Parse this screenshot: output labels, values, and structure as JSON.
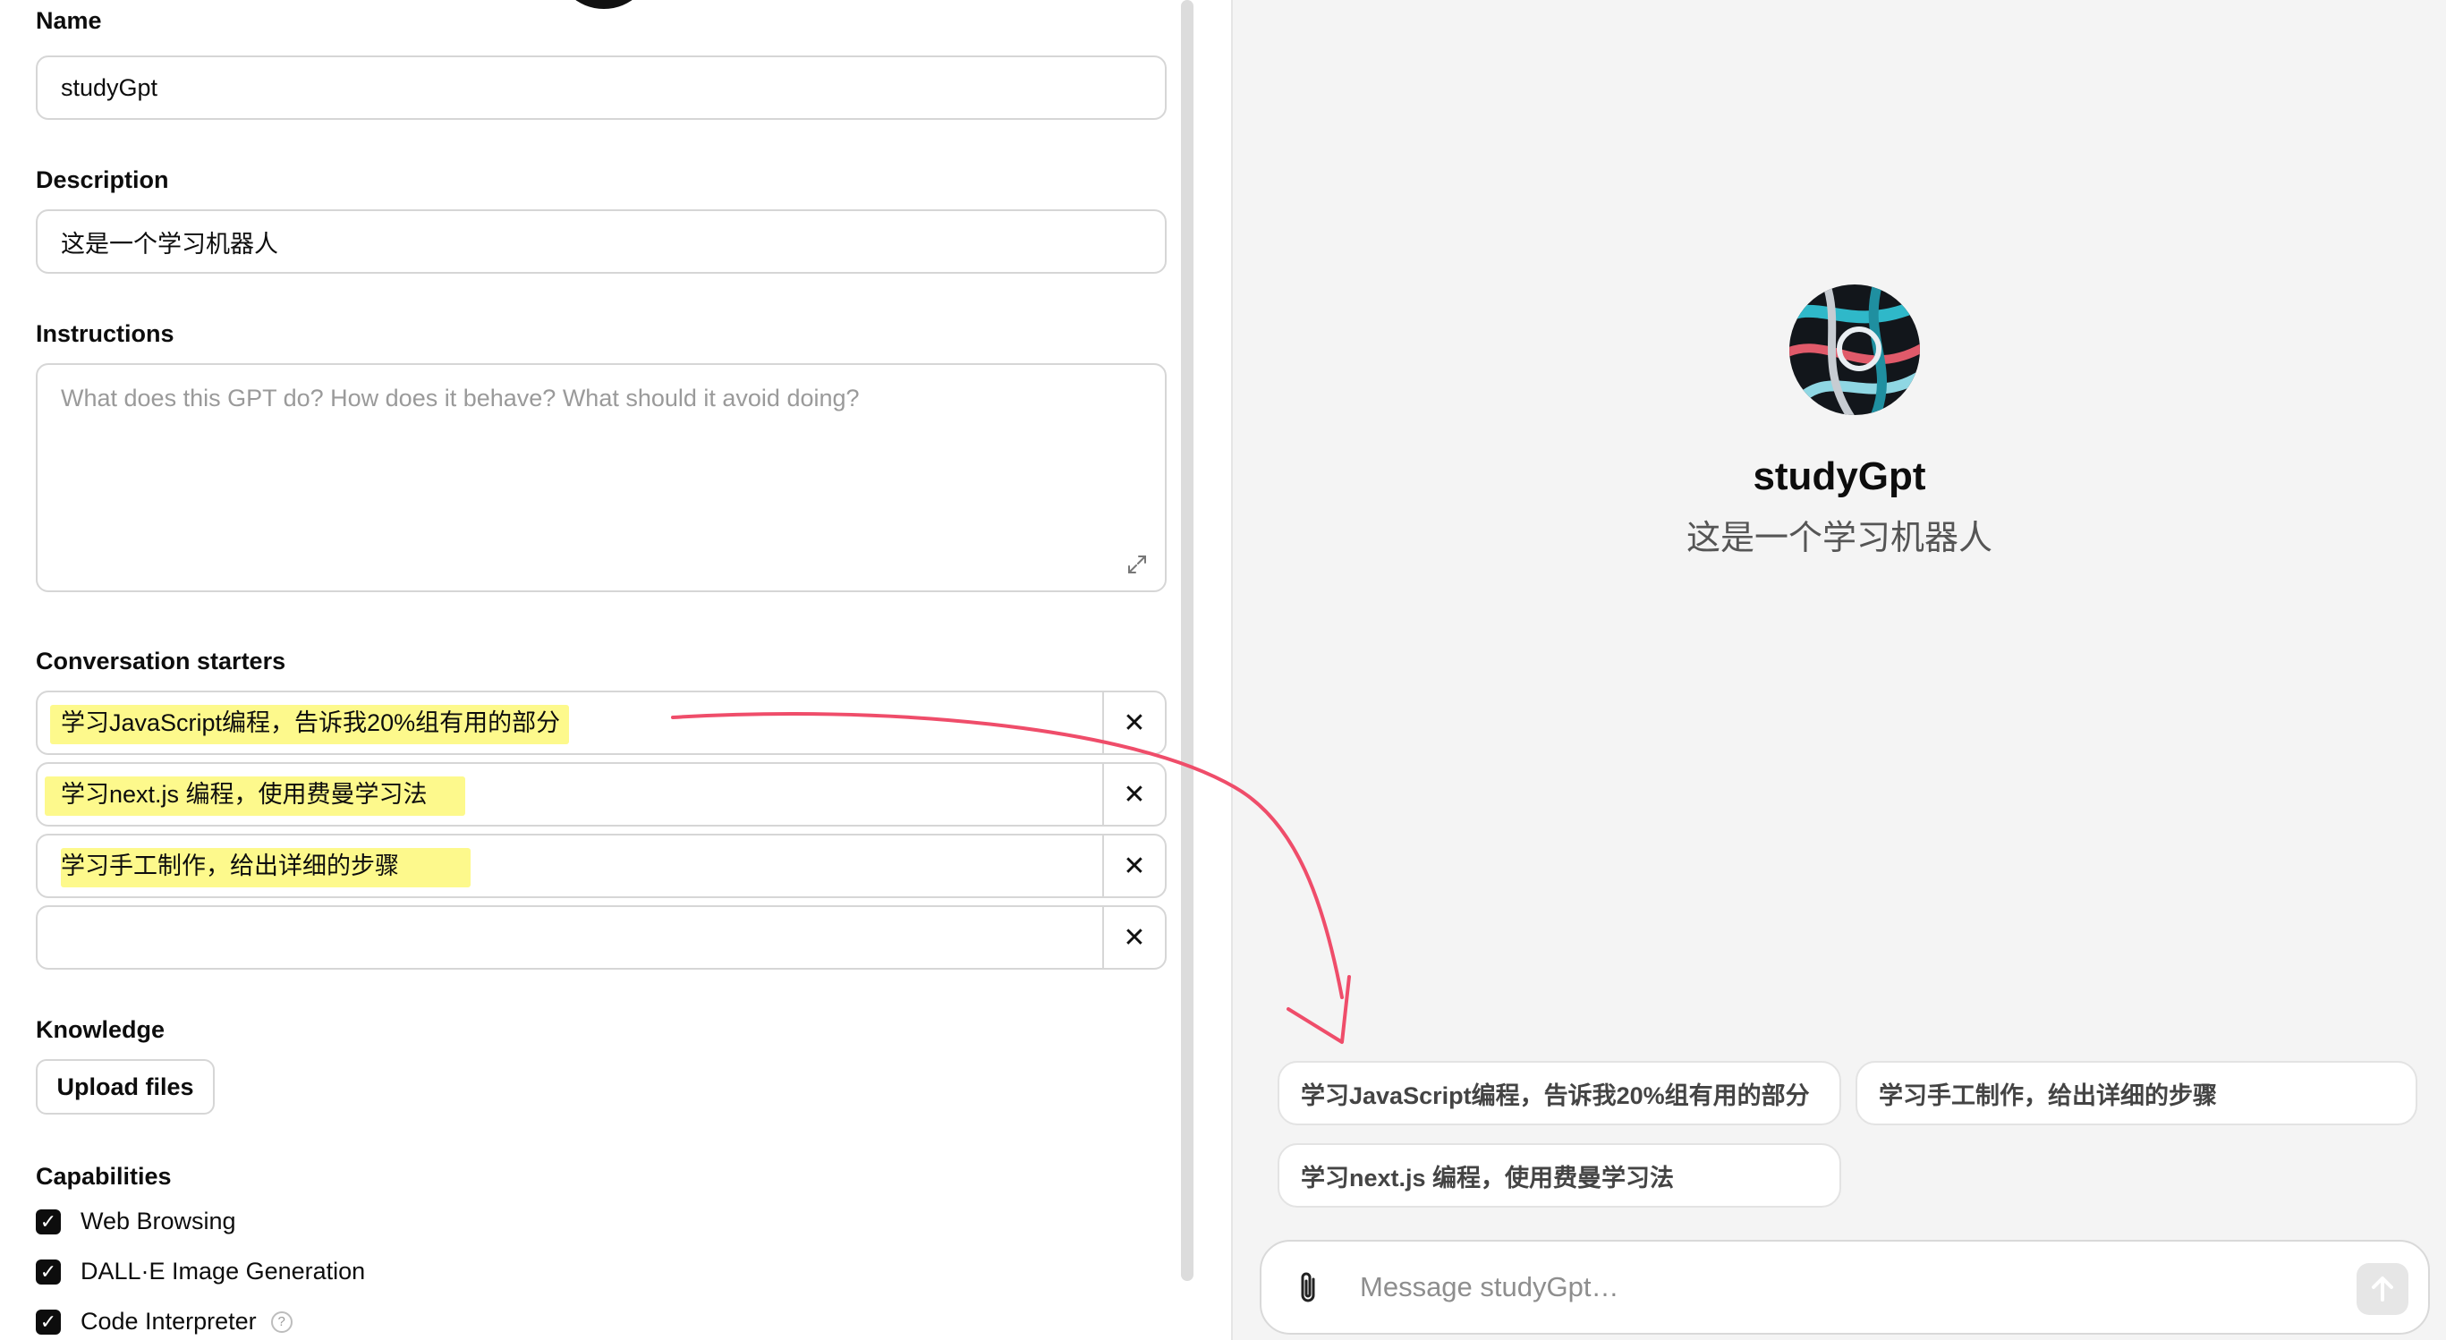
{
  "editor": {
    "name_label": "Name",
    "name_value": "studyGpt",
    "description_label": "Description",
    "description_value": "这是一个学习机器人",
    "instructions_label": "Instructions",
    "instructions_placeholder": "What does this GPT do? How does it behave? What should it avoid doing?",
    "starters_label": "Conversation starters",
    "starters": [
      "学习JavaScript编程，告诉我20%组有用的部分",
      "学习next.js 编程，使用费曼学习法",
      "学习手工制作，给出详细的步骤",
      ""
    ],
    "remove_glyph": "✕",
    "knowledge_label": "Knowledge",
    "upload_label": "Upload files",
    "capabilities_label": "Capabilities",
    "capabilities": [
      "Web Browsing",
      "DALL·E Image Generation",
      "Code Interpreter"
    ],
    "help_glyph": "?"
  },
  "preview": {
    "gpt_name": "studyGpt",
    "gpt_description": "这是一个学习机器人",
    "chips": [
      "学习JavaScript编程，告诉我20%组有用的部分",
      "学习手工制作，给出详细的步骤",
      "学习next.js 编程，使用费曼学习法"
    ],
    "composer_placeholder": "Message studyGpt…"
  },
  "colors": {
    "highlight": "#fdf98c",
    "annotation_arrow": "#ef4d6a"
  },
  "icons": [
    "paperclip-icon",
    "send-arrow-icon",
    "close-icon",
    "expand-icon",
    "check-icon",
    "help-icon"
  ]
}
